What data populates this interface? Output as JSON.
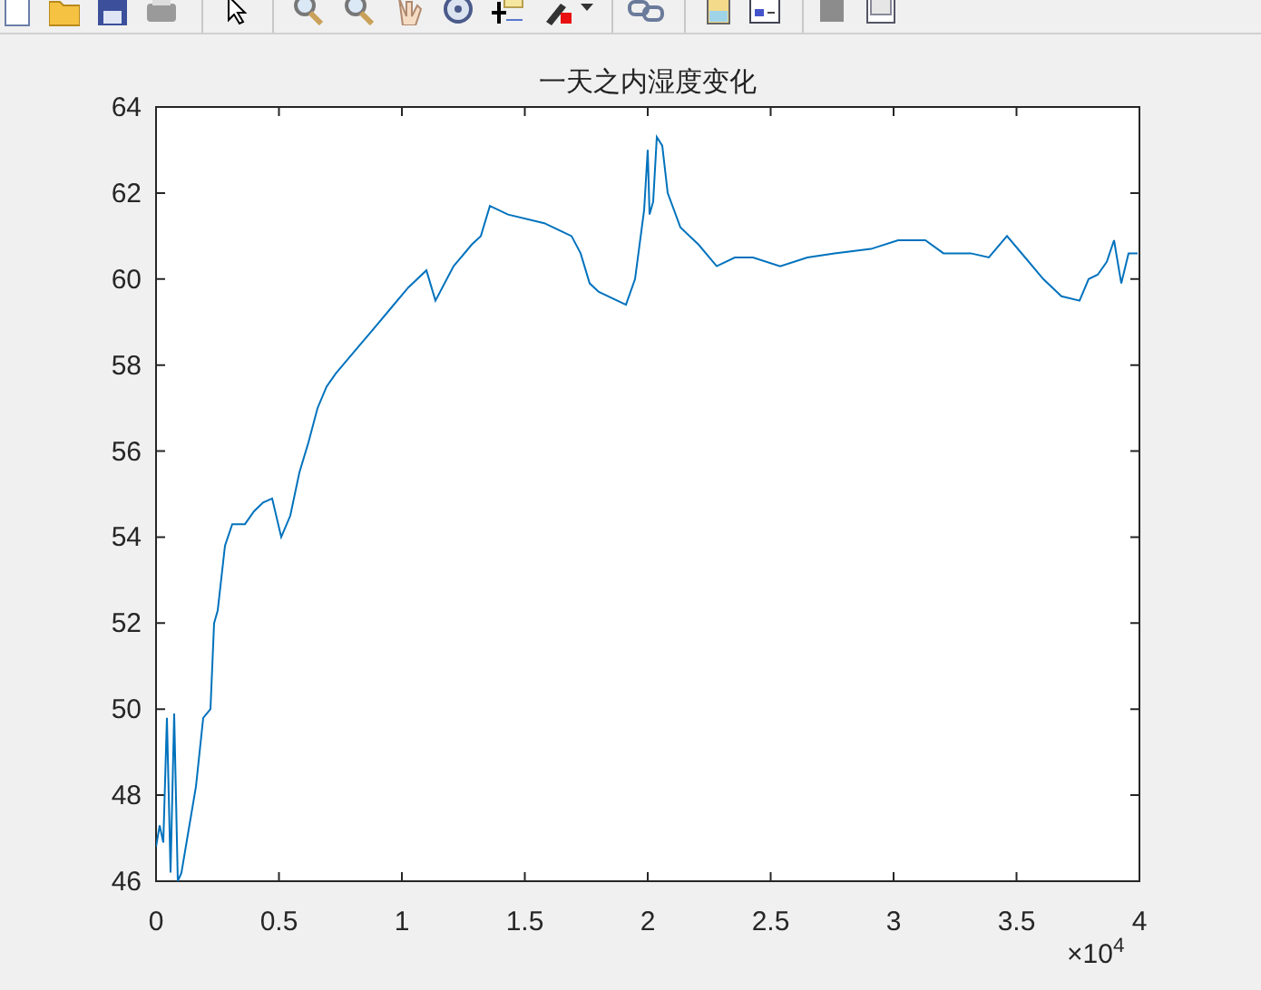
{
  "figure": {
    "axes": {
      "chart_data": {
        "type": "line",
        "title": "一天之内湿度变化",
        "x": [
          0,
          0.0148,
          0.0295,
          0.0443,
          0.059,
          0.0738,
          0.0886,
          0.1033,
          0.1328,
          0.1624,
          0.1919,
          0.2214,
          0.2362,
          0.2509,
          0.2804,
          0.31,
          0.3616,
          0.3985,
          0.4354,
          0.4723,
          0.5092,
          0.5461,
          0.583,
          0.6199,
          0.6568,
          0.6937,
          0.7306,
          0.8044,
          0.8782,
          0.952,
          1.0258,
          1.0996,
          1.1365,
          1.2103,
          1.2841,
          1.321,
          1.3579,
          1.4317,
          1.5793,
          1.69,
          1.7269,
          1.7638,
          1.8007,
          1.9114,
          1.9483,
          1.9852,
          2.0,
          2.0074,
          2.0221,
          2.0369,
          2.059,
          2.0812,
          2.1328,
          2.2066,
          2.2804,
          2.3542,
          2.428,
          2.5387,
          2.6494,
          2.7601,
          2.9077,
          3.0185,
          3.1292,
          3.203,
          3.3137,
          3.3875,
          3.4613,
          3.5351,
          3.6089,
          3.6827,
          3.7565,
          3.7934,
          3.8303,
          3.8672,
          3.8967,
          3.9262,
          3.9557,
          3.9926
        ],
        "series": [
          {
            "color": "#0072bd",
            "values": [
              46.8,
              47.3,
              46.9,
              49.8,
              46.2,
              49.9,
              46.0,
              46.2,
              47.2,
              48.2,
              49.8,
              50.0,
              52.0,
              52.3,
              53.8,
              54.3,
              54.3,
              54.6,
              54.8,
              54.9,
              54.0,
              54.5,
              55.5,
              56.2,
              57.0,
              57.5,
              57.8,
              58.3,
              58.8,
              59.3,
              59.8,
              60.2,
              59.5,
              60.3,
              60.8,
              61.0,
              61.7,
              61.5,
              61.3,
              61.0,
              60.6,
              59.9,
              59.7,
              59.4,
              60.0,
              61.6,
              63.0,
              61.5,
              61.8,
              63.3,
              63.1,
              62.0,
              61.2,
              60.8,
              60.3,
              60.5,
              60.5,
              60.3,
              60.5,
              60.6,
              60.7,
              60.9,
              60.9,
              60.6,
              60.6,
              60.5,
              61.0,
              60.5,
              60.0,
              59.6,
              59.5,
              60.0,
              60.1,
              60.4,
              60.9,
              59.9,
              60.6,
              60.6
            ]
          }
        ],
        "xlim": [
          0,
          4
        ],
        "ylim": [
          46,
          64
        ],
        "xticks": [
          0,
          0.5,
          1,
          1.5,
          2,
          2.5,
          3,
          3.5,
          4
        ],
        "yticks": [
          46,
          48,
          50,
          52,
          54,
          56,
          58,
          60,
          62,
          64
        ]
      },
      "x_exponent": "×10$^{4}$"
    }
  }
}
